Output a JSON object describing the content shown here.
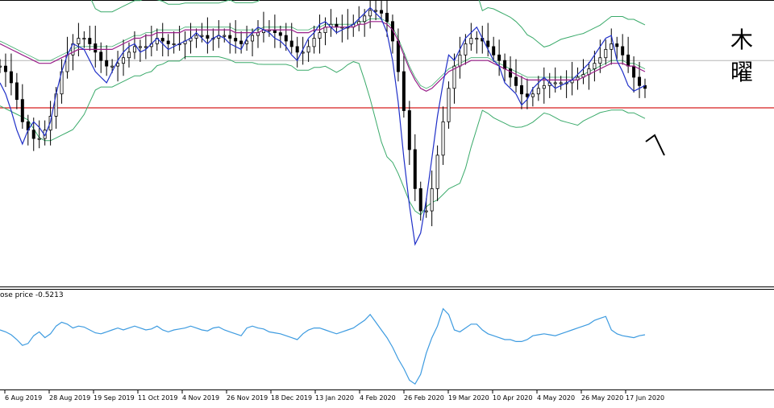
{
  "annotation_text": "木曜",
  "oscillator_label": "ose price -0.5213",
  "colors": {
    "background": "#ffffff",
    "bull_candle": "#ffffff",
    "bear_candle": "#000000",
    "wick": "#000000",
    "bollinger": "#3aaa6a",
    "ma_fast": "#1f2fc8",
    "ma_slow": "#9a1f8a",
    "support_line": "#d81e1e",
    "price_line": "#b5b5b5",
    "oscillator": "#3d9be0",
    "separator": "#000000",
    "arrow": "#000000"
  },
  "chart_data": {
    "type": "line",
    "title": "",
    "xlabel": "",
    "ylabel": "",
    "x_ticks": [
      "6 Aug 2019",
      "28 Aug 2019",
      "19 Sep 2019",
      "11 Oct 2019",
      "4 Nov 2019",
      "26 Nov 2019",
      "18 Dec 2019",
      "13 Jan 2020",
      "4 Feb 2020",
      "26 Feb 2020",
      "19 Mar 2020",
      "10 Apr 2020",
      "4 May 2020",
      "26 May 2020",
      "17 Jun 2020"
    ],
    "ylim": [
      0,
      100
    ],
    "osc_ylim": [
      0,
      100
    ],
    "series": [
      {
        "values": [
          72,
          68,
          62,
          55,
          50,
          55,
          58,
          56,
          53,
          58,
          68,
          76,
          82,
          86,
          85,
          84,
          80,
          76,
          74,
          72,
          76,
          80,
          83,
          85,
          86,
          83,
          84,
          86,
          88,
          86,
          84,
          85,
          86,
          87,
          88,
          90,
          88,
          86,
          88,
          89,
          88,
          86,
          85,
          84,
          88,
          90,
          92,
          91,
          90,
          88,
          87,
          85,
          82,
          80,
          84,
          88,
          90,
          93,
          94,
          92,
          90,
          91,
          92,
          93,
          95,
          97,
          99,
          97,
          95,
          90,
          80,
          65,
          45,
          28,
          14,
          18,
          30,
          45,
          60,
          72,
          82,
          80,
          84,
          88,
          90,
          92,
          88,
          84,
          80,
          78,
          72,
          70,
          68,
          64,
          66,
          70,
          72,
          74,
          72,
          70,
          71,
          72,
          73,
          75,
          77,
          79,
          82,
          85,
          88,
          89,
          80,
          76,
          71,
          69,
          70,
          71
        ]
      },
      {
        "values": [
          86,
          85,
          84,
          83,
          82,
          81,
          80,
          79,
          79,
          79,
          80,
          81,
          82,
          83,
          84,
          84,
          84,
          84,
          84,
          84,
          84,
          85,
          86,
          87,
          88,
          88,
          89,
          89,
          90,
          90,
          90,
          90,
          90,
          91,
          91,
          91,
          91,
          91,
          91,
          91,
          91,
          91,
          90,
          90,
          90,
          90,
          90,
          91,
          91,
          91,
          91,
          91,
          91,
          90,
          90,
          90,
          91,
          91,
          92,
          92,
          92,
          92,
          92,
          92,
          93,
          93,
          94,
          94,
          94,
          93,
          91,
          87,
          82,
          77,
          73,
          70,
          69,
          70,
          72,
          74,
          76,
          77,
          78,
          79,
          80,
          80,
          80,
          80,
          79,
          78,
          77,
          76,
          75,
          74,
          73,
          73,
          73,
          73,
          73,
          73,
          73,
          73,
          73,
          73,
          74,
          75,
          76,
          77,
          78,
          79,
          79,
          79,
          78,
          78,
          77,
          76
        ]
      },
      {
        "values": [
          78,
          76,
          72,
          66,
          58,
          55,
          52,
          52,
          55,
          60,
          68,
          76,
          82,
          86,
          88,
          88,
          86,
          83,
          80,
          78,
          78,
          79,
          81,
          83,
          85,
          85,
          85,
          86,
          88,
          87,
          86,
          86,
          86,
          87,
          88,
          89,
          89,
          88,
          88,
          89,
          89,
          88,
          87,
          86,
          87,
          89,
          90,
          91,
          91,
          90,
          89,
          87,
          85,
          83,
          83,
          85,
          88,
          90,
          92,
          93,
          92,
          92,
          92,
          93,
          94,
          96,
          98,
          98,
          97,
          94,
          87,
          76,
          62,
          48,
          34,
          26,
          26,
          34,
          46,
          58,
          70,
          78,
          82,
          86,
          88,
          88,
          87,
          85,
          82,
          80,
          77,
          74,
          71,
          68,
          67,
          68,
          70,
          71,
          72,
          72,
          72,
          72,
          73,
          74,
          75,
          77,
          79,
          81,
          84,
          86,
          85,
          82,
          78,
          74,
          71,
          70
        ]
      },
      {
        "values": [
          63,
          63,
          63,
          63,
          63,
          63,
          63,
          63,
          63,
          63,
          63,
          63,
          63,
          63,
          63,
          63,
          63,
          63,
          63,
          63,
          63,
          63,
          63,
          63,
          63,
          63,
          63,
          63,
          63,
          63,
          63,
          63,
          63,
          63,
          63,
          63,
          63,
          63,
          63,
          63,
          63,
          63,
          63,
          63,
          63,
          63,
          63,
          63,
          63,
          63,
          63,
          63,
          63,
          63,
          63,
          63,
          63,
          63,
          63,
          63,
          63,
          63,
          63,
          63,
          63,
          63,
          63,
          63,
          63,
          63,
          63,
          63,
          63,
          63,
          63,
          63,
          63,
          63,
          63,
          63,
          63,
          63,
          63,
          63,
          63,
          63,
          63,
          63,
          63,
          63,
          63,
          63,
          63,
          63,
          63,
          63,
          63,
          63,
          63,
          63,
          63,
          63,
          63,
          63,
          63,
          63,
          63,
          63,
          63,
          63,
          63,
          63,
          63,
          63,
          63,
          63
        ]
      },
      {
        "values": [
          80,
          80,
          80,
          80,
          80,
          80,
          80,
          80,
          80,
          80,
          80,
          80,
          80,
          80,
          80,
          80,
          80,
          80,
          80,
          80,
          80,
          80,
          80,
          80,
          80,
          80,
          80,
          80,
          80,
          80,
          80,
          80,
          80,
          80,
          80,
          80,
          80,
          80,
          80,
          80,
          80,
          80,
          80,
          80,
          80,
          80,
          80,
          80,
          80,
          80,
          80,
          80,
          80,
          80,
          80,
          80,
          80,
          80,
          80,
          80,
          80,
          80,
          80,
          80,
          80,
          80,
          80,
          80,
          80,
          80,
          80,
          80,
          80,
          80,
          80,
          80,
          80,
          80,
          80,
          80,
          80,
          80,
          80,
          80,
          80,
          80,
          80,
          80,
          80,
          80,
          80,
          80,
          80,
          80,
          80,
          80,
          80,
          80,
          80,
          80,
          80,
          80,
          80,
          80,
          80,
          80,
          80,
          80,
          80,
          80,
          80,
          80,
          80,
          80,
          80,
          80
        ]
      },
      {
        "values": [
          60,
          58,
          55,
          50,
          44,
          46,
          54,
          58,
          52,
          56,
          64,
          68,
          66,
          62,
          64,
          63,
          60,
          57,
          56,
          58,
          60,
          62,
          60,
          62,
          64,
          62,
          60,
          61,
          64,
          60,
          58,
          60,
          61,
          62,
          64,
          62,
          60,
          59,
          62,
          63,
          60,
          58,
          56,
          54,
          62,
          64,
          62,
          61,
          58,
          57,
          56,
          54,
          52,
          50,
          56,
          60,
          62,
          62,
          60,
          58,
          56,
          58,
          60,
          62,
          66,
          70,
          76,
          68,
          60,
          52,
          42,
          30,
          20,
          8,
          4,
          14,
          36,
          52,
          64,
          82,
          76,
          60,
          58,
          62,
          66,
          66,
          60,
          56,
          54,
          52,
          50,
          50,
          48,
          48,
          50,
          54,
          55,
          56,
          55,
          54,
          56,
          58,
          60,
          62,
          64,
          66,
          70,
          72,
          74,
          60,
          56,
          54,
          53,
          52,
          54,
          55
        ]
      }
    ]
  }
}
